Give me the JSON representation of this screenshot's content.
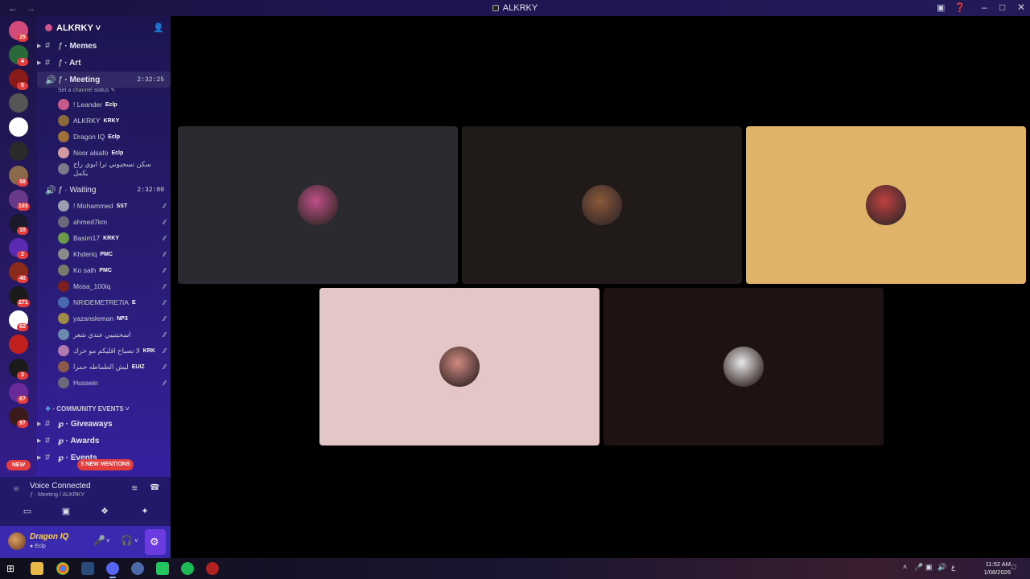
{
  "window": {
    "title": "ALKRKY"
  },
  "server": {
    "name": "ALKRKY",
    "servers": [
      {
        "badge": "25"
      },
      {
        "badge": "4"
      },
      {
        "badge": "5"
      },
      {
        "badge": ""
      },
      {
        "badge": ""
      },
      {
        "badge": ""
      },
      {
        "badge": "58"
      },
      {
        "badge": "193"
      },
      {
        "badge": "10"
      },
      {
        "badge": "2"
      },
      {
        "badge": "40"
      },
      {
        "badge": "271"
      },
      {
        "badge": "62"
      },
      {
        "badge": ""
      },
      {
        "badge": "3"
      },
      {
        "badge": "67"
      },
      {
        "badge": "97"
      }
    ],
    "new_label": "NEW"
  },
  "channels": {
    "memes": "Memes",
    "art": "Art",
    "meeting": {
      "label": "Meeting",
      "time": "2:32:25",
      "status": "Set a channel status"
    },
    "meeting_members": [
      {
        "name": "! Leander",
        "tag": "Eclp"
      },
      {
        "name": "ALKRKY",
        "tag": "KRKY"
      },
      {
        "name": "Dragon IQ",
        "tag": "Eclp"
      },
      {
        "name": "Noor alsafo",
        "tag": "Eclp"
      },
      {
        "name": "سكن تسجيوني ترا ابوي راح يكمل",
        "tag": ""
      }
    ],
    "waiting": {
      "label": "Waiting",
      "time": "2:32:00"
    },
    "waiting_members": [
      {
        "name": "! Mohammed",
        "tag": "SST"
      },
      {
        "name": "ahmed7km",
        "tag": ""
      },
      {
        "name": "Basim17",
        "tag": "KRKY"
      },
      {
        "name": "Khderiq",
        "tag": "PMC"
      },
      {
        "name": "Ko salh",
        "tag": "PMC"
      },
      {
        "name": "Mosa_100iq",
        "tag": ""
      },
      {
        "name": "NRIDEMETRE7IA",
        "tag": "E"
      },
      {
        "name": "yazansleman",
        "tag": "NP3"
      },
      {
        "name": "اسحبتيبي عندي شعر",
        "tag": ""
      },
      {
        "name": "لا تصباح اقليكم مو حرك",
        "tag": "KRK"
      },
      {
        "name": "ليش الطماطه حمرا",
        "tag": "EUIZ"
      },
      {
        "name": "Hussein",
        "tag": ""
      }
    ],
    "category": "COMMUNITY EVENTS",
    "giveaways": "Giveaways",
    "awards": "Awards",
    "events": "Events",
    "mentions_pill": "5 NEW MENTIONS"
  },
  "voice": {
    "status": "Voice Connected",
    "location": "Meeting / ALKRKY"
  },
  "user": {
    "name": "Dragon IQ",
    "subtitle": "Eclp"
  },
  "stage": {
    "tiles": [
      {
        "bg": "#2b2a31",
        "avatar": "#c0508a"
      },
      {
        "bg": "#201a18",
        "avatar": "#8a5a3a"
      },
      {
        "bg": "#dfb468",
        "avatar": "#c04040"
      },
      {
        "bg": "#e4c6c6",
        "avatar": "#d08a80"
      },
      {
        "bg": "#1e1212",
        "avatar": "#e8e8e8"
      }
    ]
  },
  "taskbar": {
    "time": "11:52 AM",
    "date": "1/08/2026",
    "lang": "ع"
  },
  "colors": {
    "accent": "#5865f2",
    "mention_red": "#e33d3d",
    "sidebar_top": "#1c1550",
    "sidebar_bottom": "#3a22b0"
  }
}
